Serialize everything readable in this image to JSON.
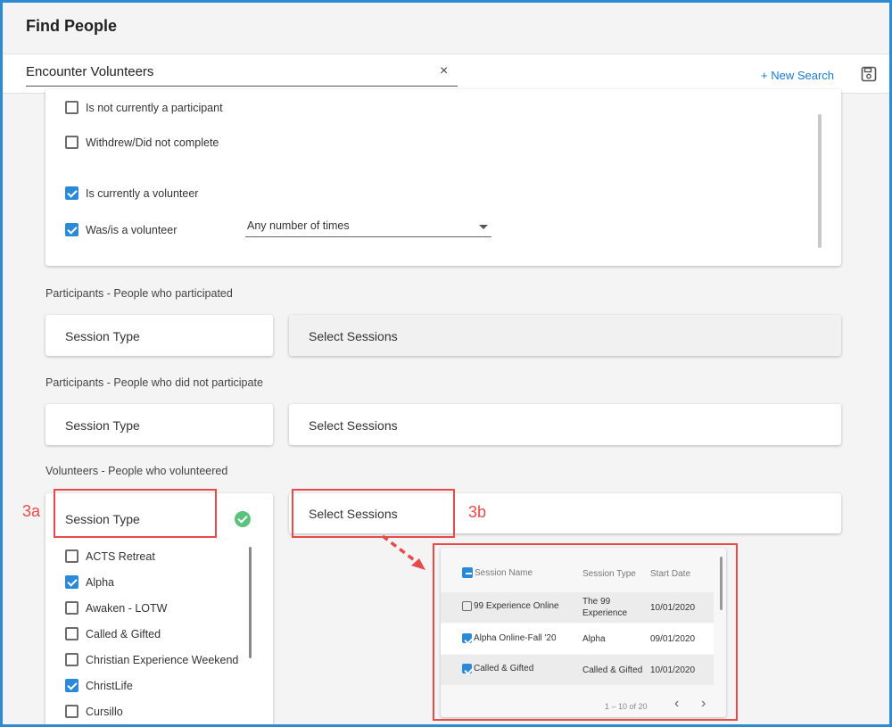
{
  "header": {
    "title": "Find People"
  },
  "search": {
    "value": "Encounter Volunteers",
    "clear_icon": "×",
    "new_search_label": "+ New Search"
  },
  "status_filters": [
    {
      "label": "Is not currently a participant",
      "checked": false
    },
    {
      "label": "Withdrew/Did not complete",
      "checked": false
    },
    {
      "label": "Is currently a volunteer",
      "checked": true
    },
    {
      "label": "Was/is a volunteer",
      "checked": true
    }
  ],
  "volunteer_times_select": {
    "value": "Any number of times"
  },
  "sections": [
    {
      "label": "Participants - People who participated",
      "session_type_label": "Session Type",
      "select_sessions_label": "Select Sessions"
    },
    {
      "label": "Participants - People who did not participate",
      "session_type_label": "Session Type",
      "select_sessions_label": "Select Sessions"
    },
    {
      "label": "Volunteers - People who volunteered",
      "session_type_label": "Session Type",
      "select_sessions_label": "Select Sessions"
    }
  ],
  "annotations": {
    "a": "3a",
    "b": "3b"
  },
  "session_types": [
    {
      "label": "ACTS Retreat",
      "checked": false
    },
    {
      "label": "Alpha",
      "checked": true
    },
    {
      "label": "Awaken - LOTW",
      "checked": false
    },
    {
      "label": "Called & Gifted",
      "checked": false
    },
    {
      "label": "Christian Experience Weekend",
      "checked": false
    },
    {
      "label": "ChristLife",
      "checked": true
    },
    {
      "label": "Cursillo",
      "checked": false
    }
  ],
  "sessions_table": {
    "columns": [
      "Session Name",
      "Session Type",
      "Start Date"
    ],
    "rows": [
      {
        "name": "99 Experience Online",
        "type_line1": "The 99",
        "type_line2": "Experience",
        "date": "10/01/2020",
        "checked": false
      },
      {
        "name": "Alpha Online-Fall '20",
        "type_line1": "Alpha",
        "type_line2": "",
        "date": "09/01/2020",
        "checked": true
      },
      {
        "name": "Called & Gifted",
        "type_line1": "Called & Gifted",
        "type_line2": "",
        "date": "10/01/2020",
        "checked": true
      }
    ],
    "pagination": "1 – 10 of 20"
  },
  "colors": {
    "accent": "#2b8ad8",
    "annotation": "#e84a4a",
    "frame": "#2e8bd1",
    "success": "#5ac27a"
  },
  "icons": {
    "save": "save-icon",
    "clear": "close-icon",
    "prev": "chevron-left-icon",
    "next": "chevron-right-icon",
    "done": "check-circle-icon"
  }
}
